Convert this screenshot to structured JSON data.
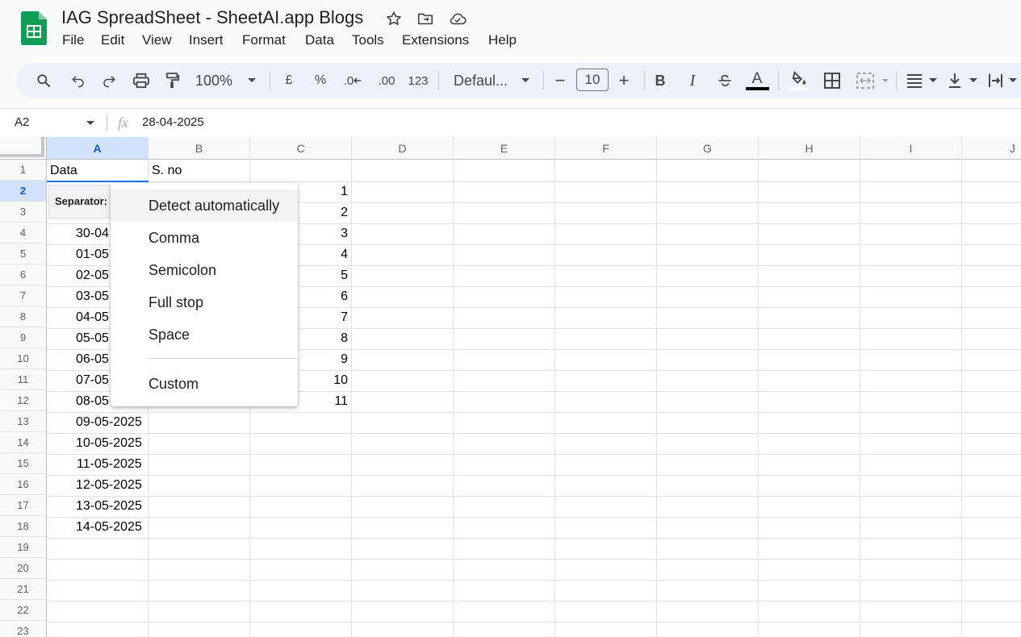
{
  "doc": {
    "title": "IAG SpreadSheet - SheetAI.app Blogs"
  },
  "header_icons": [
    "star-icon",
    "move-to-folder-icon",
    "cloud-saved-icon"
  ],
  "menu": [
    "File",
    "Edit",
    "View",
    "Insert",
    "Format",
    "Data",
    "Tools",
    "Extensions",
    "Help"
  ],
  "toolbar": {
    "zoom": "100%",
    "currency": "£",
    "percent": "%",
    "decrease_decimal": ".0",
    "increase_decimal": ".00",
    "number_format": "123",
    "font": "Defaul...",
    "font_size": "10",
    "minus": "−",
    "plus": "+",
    "bold": "B",
    "italic": "I",
    "text_color_letter": "A"
  },
  "formula_bar": {
    "name_box": "A2",
    "fx": "fx",
    "value": "28-04-2025"
  },
  "columns": [
    "A",
    "B",
    "C",
    "D",
    "E",
    "F",
    "G",
    "H",
    "I",
    "J"
  ],
  "rows": [
    "1",
    "2",
    "3",
    "4",
    "5",
    "6",
    "7",
    "8",
    "9",
    "10",
    "11",
    "12",
    "13",
    "14",
    "15",
    "16",
    "17",
    "18",
    "19",
    "20",
    "21",
    "22",
    "23"
  ],
  "cells": {
    "A1": "Data",
    "B1": "S. no",
    "A4": "30-04",
    "A5": "01-05",
    "A6": "02-05",
    "A7": "03-05",
    "A8": "04-05",
    "A9": "05-05",
    "A10": "06-05",
    "A11": "07-05",
    "A12": "08-05",
    "A13": "09-05-2025",
    "A14": "10-05-2025",
    "A15": "11-05-2025",
    "A16": "12-05-2025",
    "A17": "13-05-2025",
    "A18": "14-05-2025",
    "C": [
      "1",
      "2",
      "3",
      "4",
      "5",
      "6",
      "7",
      "8",
      "9",
      "10",
      "11"
    ]
  },
  "separator_chip": {
    "label": "Separator:"
  },
  "dropdown": {
    "options": [
      "Detect automatically",
      "Comma",
      "Semicolon",
      "Full stop",
      "Space"
    ],
    "custom": "Custom",
    "highlighted": "Detect automatically"
  },
  "colors": {
    "accent": "#0b57d0",
    "selected_header": "#d3e3fd",
    "toolbar_bg": "#edf2fa",
    "logo_green": "#0f9d58"
  }
}
